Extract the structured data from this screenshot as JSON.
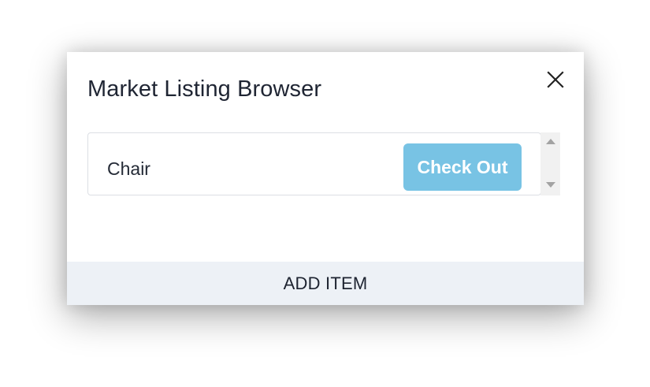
{
  "modal": {
    "title": "Market Listing Browser",
    "close_icon": "close-icon"
  },
  "listings": [
    {
      "name": "Chair",
      "action_label": "Check Out",
      "action_color": "#78c3e4"
    }
  ],
  "scrollbar": {
    "up_icon": "scroll-up-arrow-icon",
    "down_icon": "scroll-down-arrow-icon"
  },
  "footer": {
    "add_item_label": "ADD ITEM",
    "background_color": "#edf1f6"
  }
}
